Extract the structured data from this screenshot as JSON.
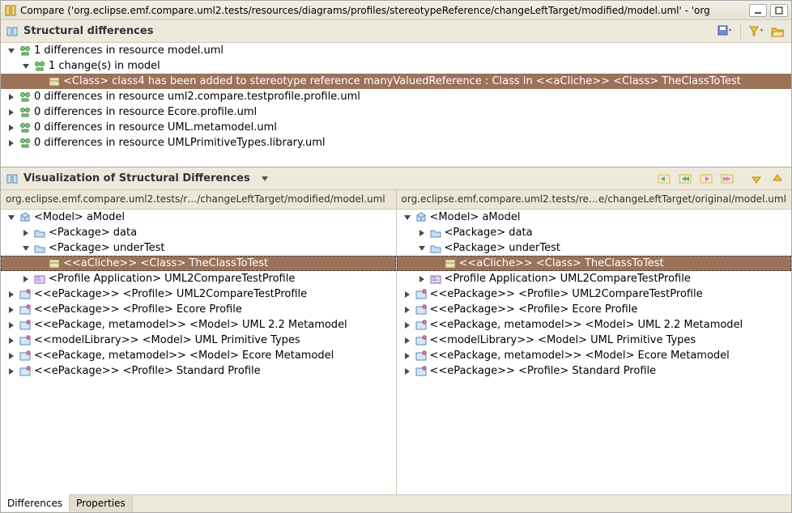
{
  "window": {
    "title": "Compare ('org.eclipse.emf.compare.uml2.tests/resources/diagrams/profiles/stereotypeReference/changeLeftTarget/modified/model.uml' - 'org"
  },
  "structural": {
    "title": "Structural differences",
    "rows": [
      {
        "indent": 0,
        "twisty": "down",
        "icon": "diff",
        "text": "1 differences in resource model.uml"
      },
      {
        "indent": 1,
        "twisty": "down",
        "icon": "diff",
        "text": "1 change(s) in model"
      },
      {
        "indent": 2,
        "twisty": "none",
        "icon": "class",
        "text": "<Class> class4 has been added to stereotype reference manyValuedReference : Class in <<aCliche>> <Class> TheClassToTest",
        "selected": true
      },
      {
        "indent": 0,
        "twisty": "right",
        "icon": "diff",
        "text": "0 differences in resource uml2.compare.testprofile.profile.uml"
      },
      {
        "indent": 0,
        "twisty": "right",
        "icon": "diff",
        "text": "0 differences in resource Ecore.profile.uml"
      },
      {
        "indent": 0,
        "twisty": "right",
        "icon": "diff",
        "text": "0 differences in resource UML.metamodel.uml"
      },
      {
        "indent": 0,
        "twisty": "right",
        "icon": "diff",
        "text": "0 differences in resource UMLPrimitiveTypes.library.uml"
      }
    ]
  },
  "viz": {
    "title": "Visualization of Structural Differences",
    "left_path": "org.eclipse.emf.compare.uml2.tests/r…/changeLeftTarget/modified/model.uml",
    "right_path": "org.eclipse.emf.compare.uml2.tests/re…e/changeLeftTarget/original/model.uml",
    "left_tree": [
      {
        "indent": 0,
        "twisty": "down",
        "icon": "model",
        "text": "<Model> aModel"
      },
      {
        "indent": 1,
        "twisty": "right",
        "icon": "folder",
        "text": "<Package> data"
      },
      {
        "indent": 1,
        "twisty": "down",
        "icon": "folder",
        "text": "<Package> underTest"
      },
      {
        "indent": 2,
        "twisty": "none",
        "icon": "class",
        "text": "<<aCliche>> <Class> TheClassToTest",
        "hl": true,
        "boxed": true
      },
      {
        "indent": 1,
        "twisty": "right",
        "icon": "profileapp",
        "text": "<Profile Application> UML2CompareTestProfile"
      },
      {
        "indent": 0,
        "twisty": "right",
        "icon": "profile",
        "text": "<<ePackage>> <Profile> UML2CompareTestProfile"
      },
      {
        "indent": 0,
        "twisty": "right",
        "icon": "profile",
        "text": "<<ePackage>> <Profile> Ecore Profile"
      },
      {
        "indent": 0,
        "twisty": "right",
        "icon": "profile",
        "text": "<<ePackage, metamodel>> <Model> UML 2.2 Metamodel"
      },
      {
        "indent": 0,
        "twisty": "right",
        "icon": "profile",
        "text": "<<modelLibrary>> <Model> UML Primitive Types"
      },
      {
        "indent": 0,
        "twisty": "right",
        "icon": "profile",
        "text": "<<ePackage, metamodel>> <Model> Ecore Metamodel"
      },
      {
        "indent": 0,
        "twisty": "right",
        "icon": "profile",
        "text": "<<ePackage>> <Profile> Standard Profile"
      }
    ],
    "right_tree": [
      {
        "indent": 0,
        "twisty": "down",
        "icon": "model",
        "text": "<Model> aModel"
      },
      {
        "indent": 1,
        "twisty": "right",
        "icon": "folder",
        "text": "<Package> data"
      },
      {
        "indent": 1,
        "twisty": "down",
        "icon": "folder",
        "text": "<Package> underTest"
      },
      {
        "indent": 2,
        "twisty": "none",
        "icon": "class",
        "text": "<<aCliche>> <Class> TheClassToTest",
        "hl": true,
        "boxed": true
      },
      {
        "indent": 1,
        "twisty": "right",
        "icon": "profileapp",
        "text": "<Profile Application> UML2CompareTestProfile"
      },
      {
        "indent": 0,
        "twisty": "right",
        "icon": "profile",
        "text": "<<ePackage>> <Profile> UML2CompareTestProfile"
      },
      {
        "indent": 0,
        "twisty": "right",
        "icon": "profile",
        "text": "<<ePackage>> <Profile> Ecore Profile"
      },
      {
        "indent": 0,
        "twisty": "right",
        "icon": "profile",
        "text": "<<ePackage, metamodel>> <Model> UML 2.2 Metamodel"
      },
      {
        "indent": 0,
        "twisty": "right",
        "icon": "profile",
        "text": "<<modelLibrary>> <Model> UML Primitive Types"
      },
      {
        "indent": 0,
        "twisty": "right",
        "icon": "profile",
        "text": "<<ePackage, metamodel>> <Model> Ecore Metamodel"
      },
      {
        "indent": 0,
        "twisty": "right",
        "icon": "profile",
        "text": "<<ePackage>> <Profile> Standard Profile"
      }
    ]
  },
  "tabs": {
    "differences": "Differences",
    "properties": "Properties"
  },
  "icons": {
    "compare": "compare-icon",
    "save": "save-icon",
    "filter": "filter-icon",
    "folderopen": "folder-open-icon"
  }
}
